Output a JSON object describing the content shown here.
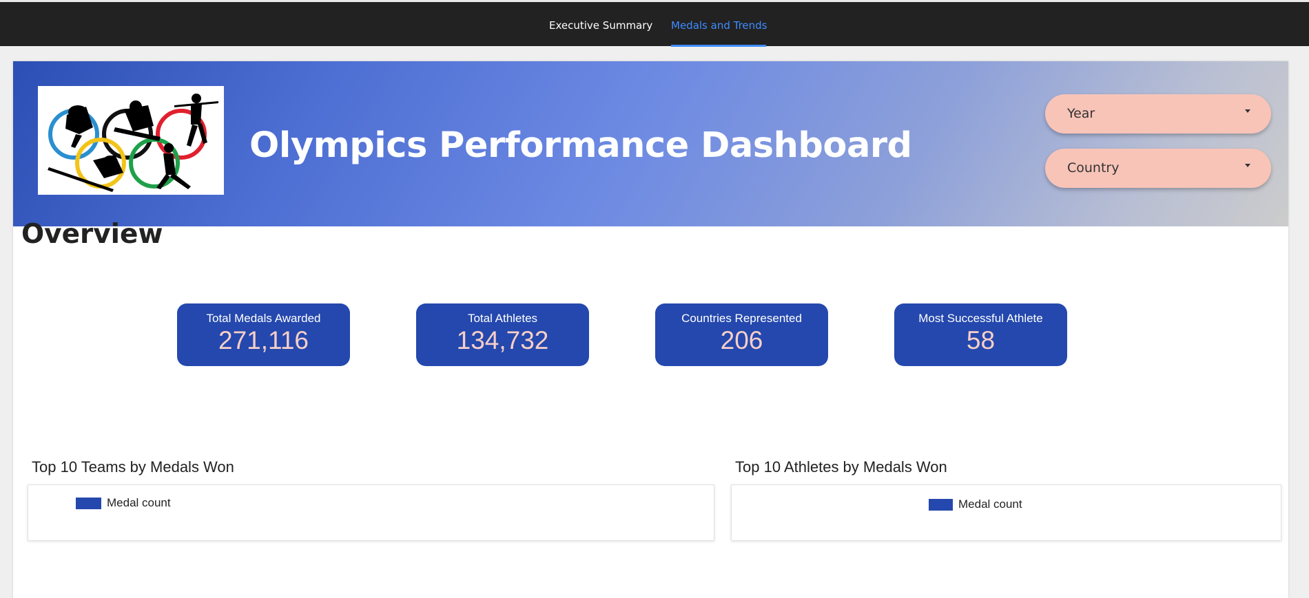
{
  "nav": {
    "tabs": [
      {
        "label": "Executive Summary",
        "active": false
      },
      {
        "label": "Medals and Trends",
        "active": true
      }
    ]
  },
  "header": {
    "title": "Olympics Performance Dashboard",
    "logo_icon": "olympic-rings-athletes-icon",
    "filters": {
      "year_label": "Year",
      "country_label": "Country"
    }
  },
  "overview": {
    "heading": "Overview",
    "kpis": [
      {
        "label": "Total Medals Awarded",
        "value": "271,116"
      },
      {
        "label": "Total Athletes",
        "value": "134,732"
      },
      {
        "label": "Countries Represented",
        "value": "206"
      },
      {
        "label": "Most Successful Athlete",
        "value": "58"
      }
    ]
  },
  "charts": {
    "teams": {
      "title": "Top 10 Teams by Medals Won",
      "legend": "Medal count"
    },
    "athletes": {
      "title": "Top 10 Athletes by Medals Won",
      "legend": "Medal count"
    }
  },
  "colors": {
    "accent": "#3f8cff",
    "kpi_bg": "#2448ad",
    "kpi_value": "#f6cfc8",
    "dropdown_bg": "#f8c4b8"
  }
}
